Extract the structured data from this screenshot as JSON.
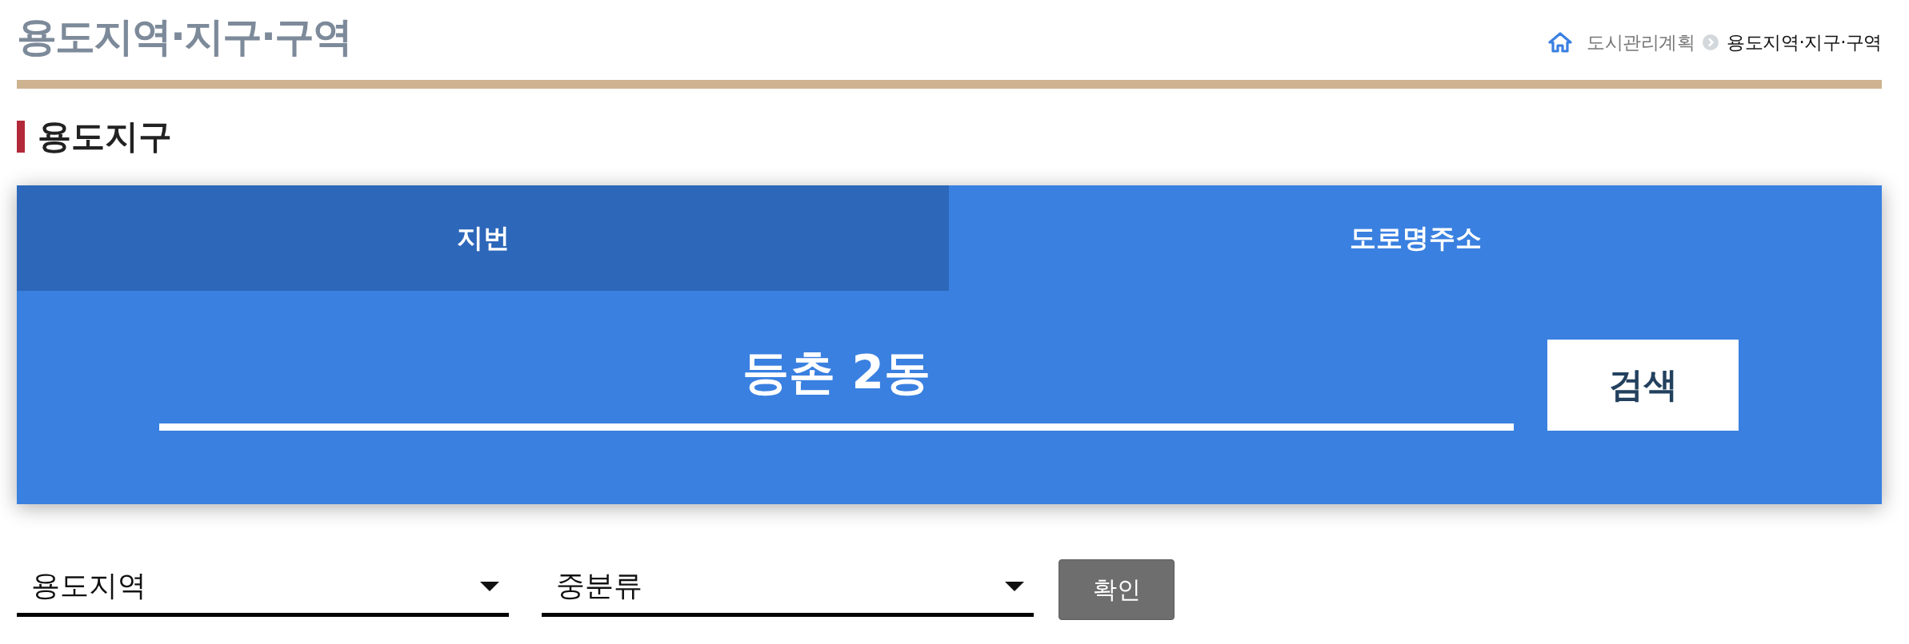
{
  "page_title": "용도지역·지구·구역",
  "breadcrumb": [
    {
      "label": "도시관리계획",
      "current": false
    },
    {
      "label": "용도지역·지구·구역",
      "current": true
    }
  ],
  "section_title": "용도지구",
  "search_panel": {
    "tabs": [
      {
        "label": "지번",
        "selected": true
      },
      {
        "label": "도로명주소",
        "selected": false
      }
    ],
    "query": {
      "value": "등촌 2동"
    },
    "button": "검색"
  },
  "filters": {
    "selects": [
      {
        "value": "용도지역"
      },
      {
        "value": "중분류"
      }
    ],
    "button": "확인"
  }
}
